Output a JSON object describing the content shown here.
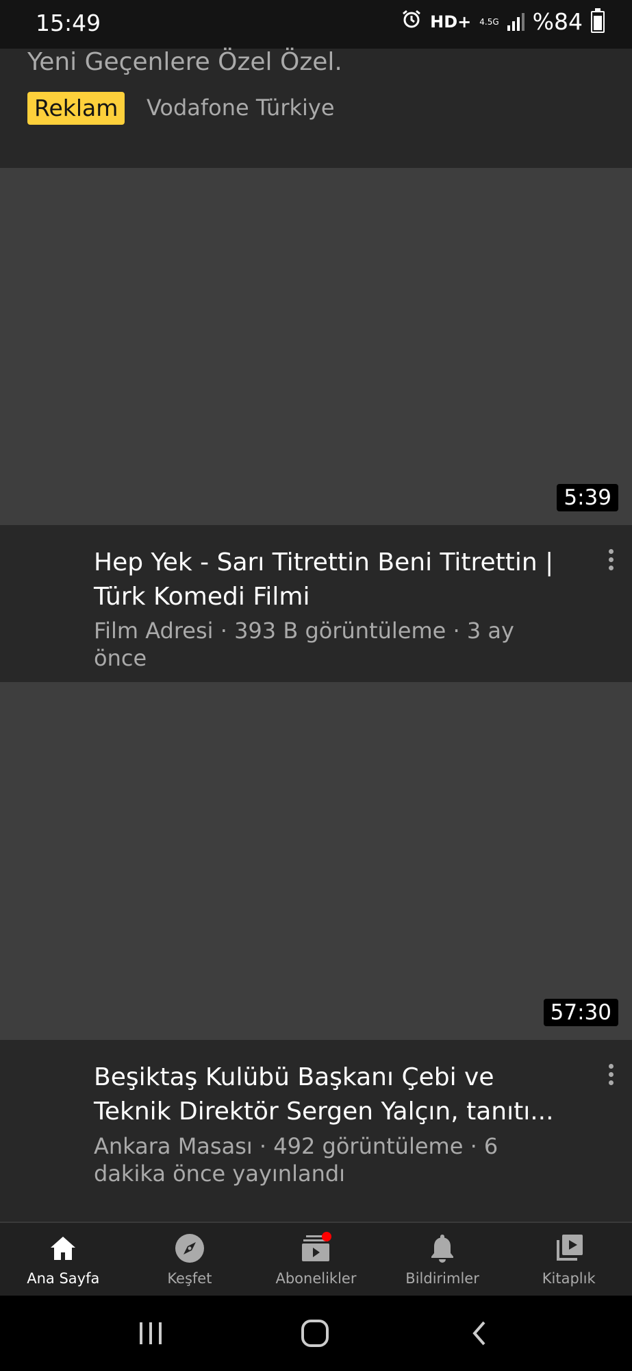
{
  "status_bar": {
    "time": "15:49",
    "network_label": "HD+",
    "network_type": "4.5G",
    "battery": "%84",
    "icons": [
      "alarm-icon",
      "signal-icon",
      "battery-icon"
    ]
  },
  "ad": {
    "text": "Yeni Geçenlere Özel Özel.",
    "badge": "Reklam",
    "advertiser": "Vodafone Türkiye",
    "badge_color": "#fdd03b"
  },
  "videos": [
    {
      "duration": "5:39",
      "title": "Hep Yek - Sarı Titrettin Beni Titrettin | Türk Komedi Filmi",
      "meta": "Film Adresi · 393 B görüntüleme · 3 ay önce"
    },
    {
      "duration": "57:30",
      "title": "Beşiktaş Kulübü Başkanı Çebi ve Teknik Direktör Sergen Yalçın, tanıtı...",
      "meta": "Ankara Masası · 492 görüntüleme · 6 dakika önce yayınlandı"
    }
  ],
  "bottom_nav": [
    {
      "label": "Ana Sayfa",
      "icon": "home-icon",
      "active": true
    },
    {
      "label": "Keşfet",
      "icon": "compass-icon",
      "active": false
    },
    {
      "label": "Abonelikler",
      "icon": "subscriptions-icon",
      "active": false,
      "badge": true
    },
    {
      "label": "Bildirimler",
      "icon": "bell-icon",
      "active": false
    },
    {
      "label": "Kitaplık",
      "icon": "library-icon",
      "active": false
    }
  ],
  "system_nav": [
    "recents-icon",
    "home-circle-icon",
    "back-icon"
  ]
}
